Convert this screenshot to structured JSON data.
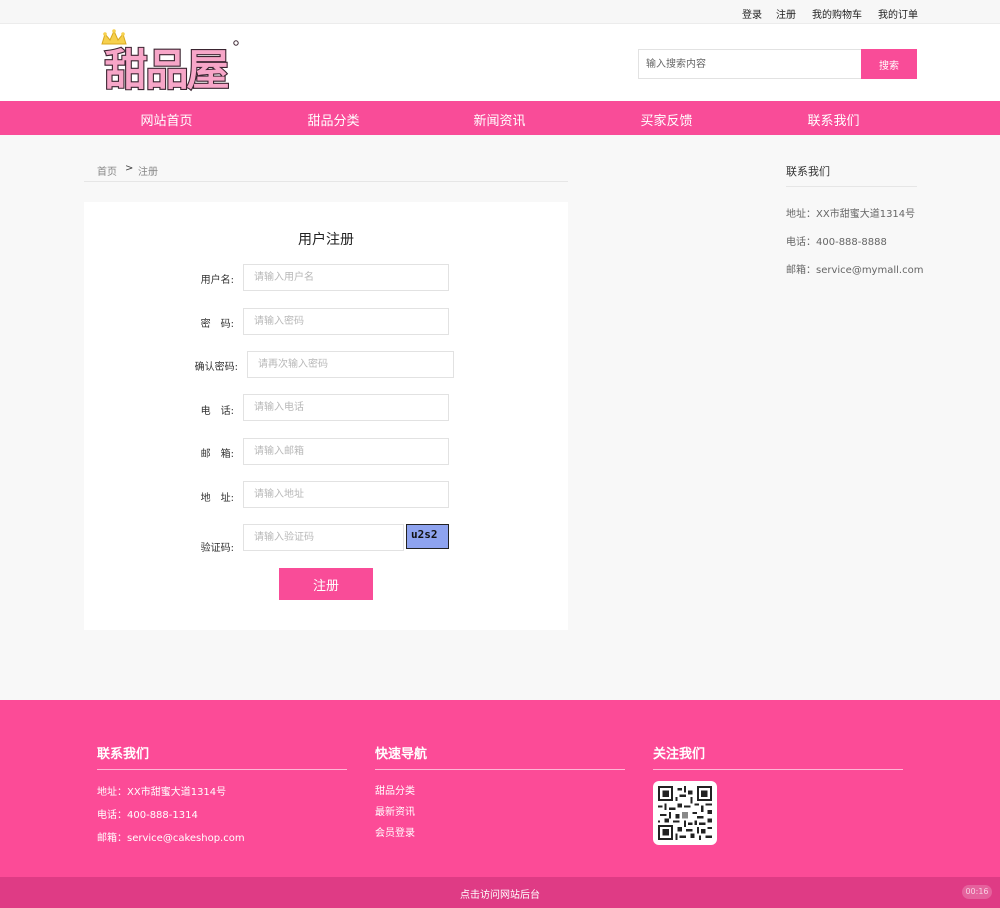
{
  "topbar": {
    "login": "登录",
    "register": "注册",
    "cart": "我的购物车",
    "orders": "我的订单"
  },
  "header": {
    "logo_text": "甜品屋",
    "search": {
      "placeholder": "输入搜索内容",
      "button": "搜索"
    }
  },
  "nav": {
    "items": [
      "网站首页",
      "甜品分类",
      "新闻资讯",
      "买家反馈",
      "联系我们"
    ]
  },
  "breadcrumb": {
    "home": "首页",
    "separator": ">",
    "current": "注册"
  },
  "form": {
    "title": "用户注册",
    "fields": [
      {
        "label": "用户名:",
        "placeholder": "请输入用户名"
      },
      {
        "label": "密　码:",
        "placeholder": "请输入密码"
      },
      {
        "label": "确认密码:",
        "placeholder": "请再次输入密码"
      },
      {
        "label": "电　话:",
        "placeholder": "请输入电话"
      },
      {
        "label": "邮　箱:",
        "placeholder": "请输入邮箱"
      },
      {
        "label": "地　址:",
        "placeholder": "请输入地址"
      },
      {
        "label": "验证码:",
        "placeholder": "请输入验证码"
      }
    ],
    "captcha": "u2s2",
    "submit": "注册"
  },
  "sidebar": {
    "title": "联系我们",
    "address": "地址：XX市甜蜜大道1314号",
    "phone": "电话：400-888-8888",
    "email": "邮箱：service@mymall.com"
  },
  "footer": {
    "contact": {
      "title": "联系我们",
      "address": "地址：XX市甜蜜大道1314号",
      "phone": "电话：400-888-1314",
      "email": "邮箱：service@cakeshop.com"
    },
    "quicknav": {
      "title": "快速导航",
      "links": [
        "甜品分类",
        "最新资讯",
        "会员登录"
      ]
    },
    "follow": {
      "title": "关注我们"
    },
    "bottom_link": "点击访问网站后台",
    "badge": "00:16"
  },
  "colors": {
    "brand_pink": "#f94c98",
    "footer_pink": "#fc4b97",
    "bottom_bar": "#df3b85",
    "captcha_bg": "#8ea3ef"
  },
  "icons": {
    "logo": "crown-logo-icon",
    "qr": "qr-code-icon"
  }
}
